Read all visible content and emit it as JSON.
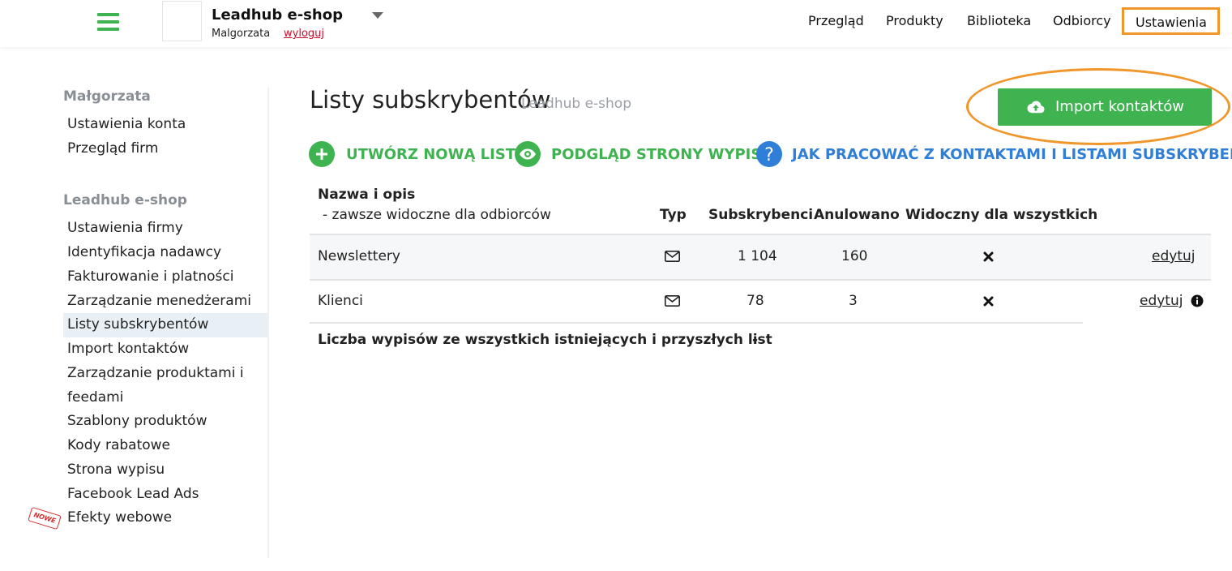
{
  "header": {
    "shop_name": "Leadhub e-shop",
    "user_name": "Malgorzata",
    "logout_label": "wyloguj",
    "nav": [
      {
        "label": "Przegląd"
      },
      {
        "label": "Produkty"
      },
      {
        "label": "Biblioteka"
      },
      {
        "label": "Odbiorcy"
      },
      {
        "label": "Ustawienia",
        "active": true
      }
    ]
  },
  "sidebar": {
    "section1_title": "Małgorzata",
    "section1_items": [
      "Ustawienia konta",
      "Przegląd firm"
    ],
    "section2_title": "Leadhub e-shop",
    "section2_items": [
      "Ustawienia firmy",
      "Identyfikacja nadawcy",
      "Fakturowanie i platności",
      "Zarządzanie menedżerami",
      "Listy subskrybentów",
      "Import kontaktów",
      "Zarządzanie produktami i",
      "feedami",
      "Szablony produktów",
      "Kody rabatowe",
      "Strona wypisu",
      "Facebook Lead Ads",
      "Efekty webowe"
    ],
    "active_item": "Listy subskrybentów",
    "new_badge": "NOWE"
  },
  "main": {
    "title": "Listy subskrybentów",
    "subtitle": "Leadhub e-shop",
    "import_button": "Import kontaktów",
    "actions": [
      {
        "label": "UTWÓRZ NOWĄ LISTĘ",
        "icon": "plus-icon",
        "color": "#3fb34f"
      },
      {
        "label": "PODGLĄD STRONY WYPISU",
        "icon": "eye-icon",
        "color": "#3fb34f"
      },
      {
        "label": "JAK PRACOWAĆ Z KONTAKTAMI I LISTAMI SUBSKRYBENTÓW",
        "icon": "help-icon",
        "color": "#2f7ed8"
      }
    ],
    "table": {
      "headers": {
        "name": "Nazwa i opis",
        "name_desc": "- zawsze widoczne dla odbiorców",
        "type": "Typ",
        "subscribers": "Subskrybenci",
        "cancelled": "Anulowano",
        "visible": "Widoczny dla wszystkich"
      },
      "rows": [
        {
          "name": "Newslettery",
          "type_icon": "envelope-icon",
          "subscribers": "1 104",
          "cancelled": "160",
          "visible_icon": "x-icon",
          "edit": "edytuj"
        },
        {
          "name": "Klienci",
          "type_icon": "envelope-icon",
          "subscribers": "78",
          "cancelled": "3",
          "visible_icon": "x-icon",
          "edit": "edytuj",
          "info_icon": "info-icon"
        }
      ],
      "footer_label": "Liczba wypisów ze wszystkich istniejących i przyszłych list",
      "footer_value": "-"
    }
  },
  "colors": {
    "accent_green": "#3fb34f",
    "accent_blue": "#2f7ed8",
    "highlight_orange": "#f0962b",
    "logout_red": "#c8102e"
  }
}
